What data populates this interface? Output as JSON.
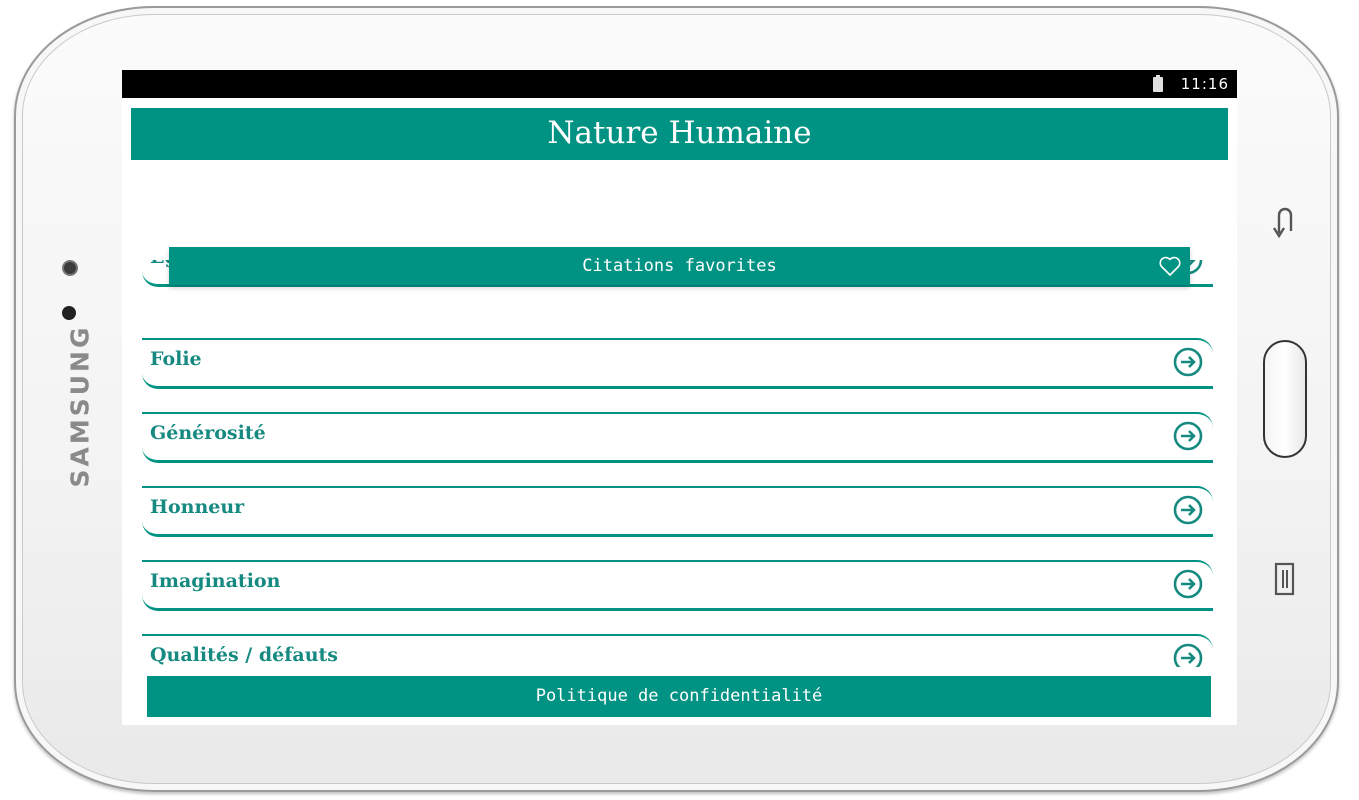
{
  "device": {
    "brand": "SAMSUNG"
  },
  "status_bar": {
    "time": "11:16",
    "icons": [
      "battery-icon"
    ]
  },
  "app": {
    "title": "Nature Humaine"
  },
  "favorites_bar": {
    "label": "Citations favorites",
    "icon": "heart-outline-icon"
  },
  "categories": [
    {
      "label": "Egoïsme",
      "icon": "arrow-right-circle-icon"
    },
    {
      "label": "Folie",
      "icon": "arrow-right-circle-icon"
    },
    {
      "label": "Générosité",
      "icon": "arrow-right-circle-icon"
    },
    {
      "label": "Honneur",
      "icon": "arrow-right-circle-icon"
    },
    {
      "label": "Imagination",
      "icon": "arrow-right-circle-icon"
    },
    {
      "label": "Qualités / défauts",
      "icon": "arrow-right-circle-icon"
    }
  ],
  "footer": {
    "privacy_label": "Politique de confidentialité"
  },
  "colors": {
    "primary": "#009383",
    "text_accent": "#168a80",
    "status_bar": "#000000"
  }
}
